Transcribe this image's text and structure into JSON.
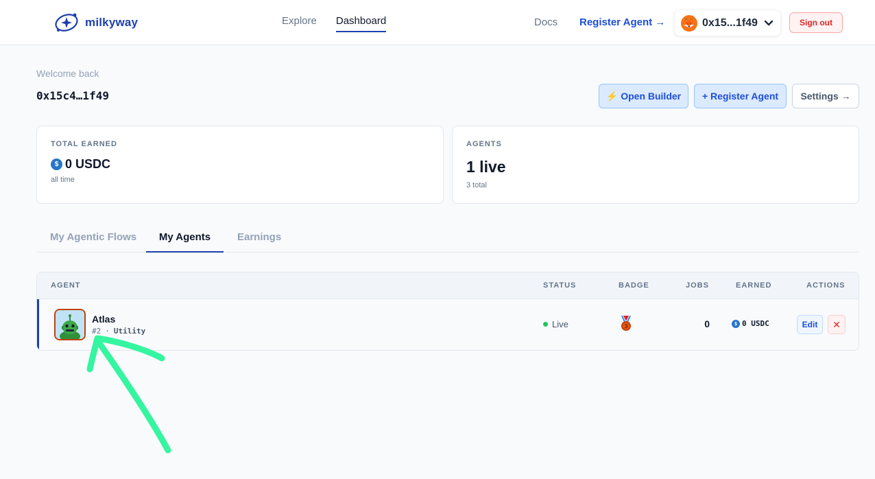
{
  "header": {
    "brand": "milkyway",
    "nav": [
      {
        "label": "Explore"
      },
      {
        "label": "Dashboard"
      }
    ],
    "docs_label": "Docs",
    "register_label": "Register Agent →",
    "wallet_address": "0x15...1f49",
    "wallet_chevron": "❯",
    "signout_label": "Sign out"
  },
  "welcome": {
    "greeting": "Welcome back",
    "address": "0x15c4…1f49"
  },
  "actions": {
    "builder_label": "⚡ Open Builder",
    "register_label": "+ Register Agent",
    "settings_label": "Settings →"
  },
  "stats": {
    "earned": {
      "label": "TOTAL EARNED",
      "value": "0 USDC",
      "sub": "all time"
    },
    "agents": {
      "label": "AGENTS",
      "value": "1 live",
      "sub": "3 total"
    }
  },
  "tabs": [
    {
      "label": "My Agentic Flows"
    },
    {
      "label": "My Agents"
    },
    {
      "label": "Earnings"
    }
  ],
  "table": {
    "headers": {
      "agent": "AGENT",
      "status": "STATUS",
      "badge": "BADGE",
      "jobs": "JOBS",
      "earned": "EARNED",
      "actions": "ACTIONS"
    },
    "rows": [
      {
        "name": "Atlas",
        "id": "#2",
        "separator": "·",
        "category": "Utility",
        "status": "Live",
        "badge_icon": "bronze-medal-icon",
        "jobs": "0",
        "earned": "0 USDC",
        "edit_label": "Edit",
        "delete_label": "✕"
      }
    ]
  },
  "colors": {
    "accent": "#1e40af",
    "live": "#22c55e",
    "danger": "#dc2626",
    "annotation": "#34f5a0"
  }
}
